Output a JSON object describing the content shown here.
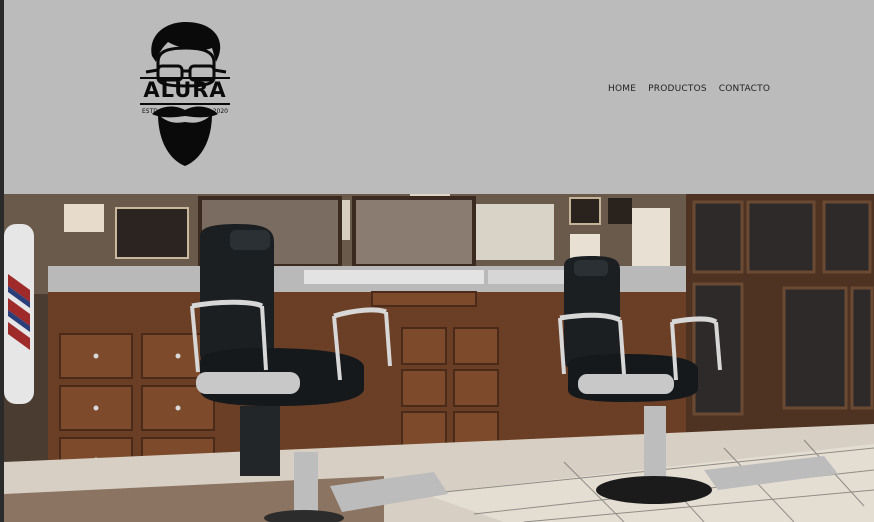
{
  "logo": {
    "brand": "ALURA",
    "estd": "ESTD",
    "year": "2020",
    "icon": "bearded-man-glasses-logo"
  },
  "nav": {
    "items": [
      {
        "label": "HOME"
      },
      {
        "label": "PRODUCTOS"
      },
      {
        "label": "CONTACTO"
      }
    ]
  },
  "hero": {
    "image": "barbershop-interior-photo"
  },
  "colors": {
    "header_bg": "#bbbbbb",
    "nav_text": "#222222",
    "logo": "#0a0a0a"
  }
}
